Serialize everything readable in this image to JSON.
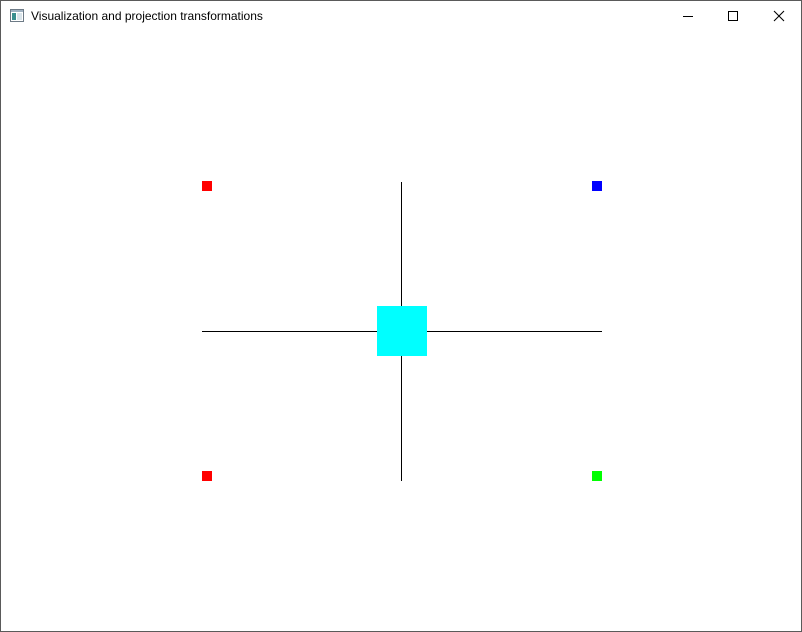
{
  "window": {
    "title": "Visualization and projection transformations",
    "icon": "app-window-icon",
    "controls": {
      "minimize_icon": "minimize-icon",
      "maximize_icon": "maximize-icon",
      "close_icon": "close-icon"
    }
  },
  "scene": {
    "background": "#ffffff",
    "axis_color": "#000000",
    "center_square_color": "#00ffff",
    "corner_markers": [
      {
        "name": "top-left",
        "color": "#ff0000"
      },
      {
        "name": "top-right",
        "color": "#0000ff"
      },
      {
        "name": "bottom-left",
        "color": "#ff0000"
      },
      {
        "name": "bottom-right",
        "color": "#00ff00"
      }
    ]
  }
}
